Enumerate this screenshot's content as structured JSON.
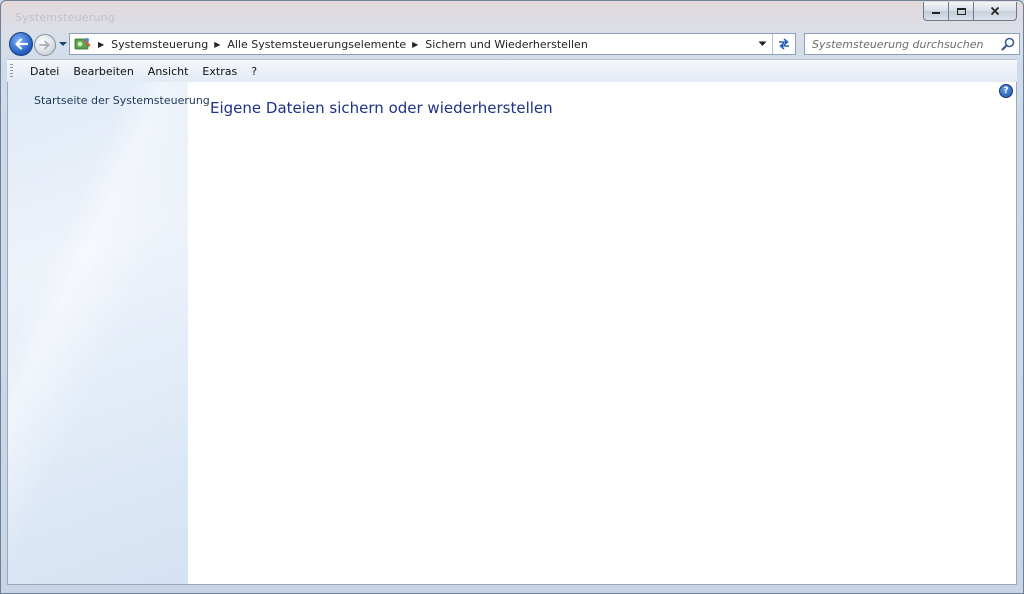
{
  "window": {
    "title": "Systemsteuerung"
  },
  "address_bar": {
    "breadcrumbs": [
      "Systemsteuerung",
      "Alle Systemsteuerungselemente",
      "Sichern und Wiederherstellen"
    ]
  },
  "search": {
    "placeholder": "Systemsteuerung durchsuchen"
  },
  "menu": {
    "items": [
      "Datei",
      "Bearbeiten",
      "Ansicht",
      "Extras",
      "?"
    ]
  },
  "sidebar": {
    "home_link": "Startseite der Systemsteuerung"
  },
  "main": {
    "title": "Eigene Dateien sichern oder wiederherstellen",
    "help_label": "?"
  },
  "colors": {
    "title_text": "#1e3287",
    "sidebar_link": "#1e395b",
    "sidebar_bg": "#e3ecf8"
  },
  "icons": [
    "back-arrow-icon",
    "forward-arrow-icon",
    "control-panel-icon",
    "chevron-down-icon",
    "refresh-icon",
    "search-icon",
    "help-icon",
    "minimize-icon",
    "maximize-icon",
    "close-icon"
  ]
}
